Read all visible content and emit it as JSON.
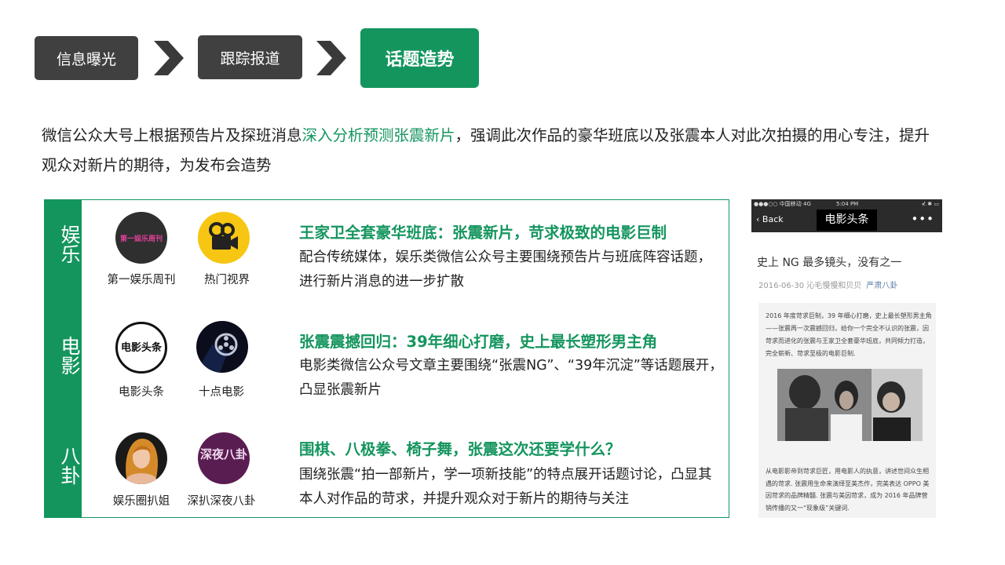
{
  "steps": [
    "信息曝光",
    "跟踪报道",
    "话题造势"
  ],
  "intro": {
    "part1": "微信公众大号上根据预告片及探班消息",
    "highlight": "深入分析预测张震新片",
    "part2": "，强调此次作品的豪华班底以及张震本人对此次拍摄的用心专注，提升观众对新片的期待，为发布会造势"
  },
  "categories": [
    {
      "label": "娱乐",
      "accounts": [
        {
          "name": "第一娱乐周刊",
          "logo_text": "第一娱乐周刊"
        },
        {
          "name": "热门视界",
          "icon": "film-camera-icon"
        }
      ],
      "headline": "王家卫全套豪华班底：张震新片，苛求极致的电影巨制",
      "description": "配合传统媒体，娱乐类微信公众号主要围绕预告片与班底阵容话题，进行新片消息的进一步扩散"
    },
    {
      "label": "电影",
      "accounts": [
        {
          "name": "电影头条",
          "logo_text": "电影头条"
        },
        {
          "name": "十点电影",
          "icon": "film-projector-icon"
        }
      ],
      "headline": "张震震撼回归：39年细心打磨，史上最长塑形男主角",
      "description": "电影类微信公众号文章主要围绕“张震NG”、“39年沉淀”等话题展开，凸显张震新片"
    },
    {
      "label": "八卦",
      "accounts": [
        {
          "name": "娱乐圈扒姐",
          "icon": "woman-portrait-icon"
        },
        {
          "name": "深扒深夜八卦",
          "logo_text": "深夜八卦"
        }
      ],
      "headline": "围棋、八极拳、椅子舞，张震这次还要学什么？",
      "description": "围绕张震“拍一部新片，学一项新技能”的特点展开话题讨论，凸显其本人对作品的苛求，并提升观众对于新片的期待与关注"
    }
  ],
  "phone": {
    "status_carrier": "●●●○○ 中国移动  4G",
    "status_time": "5:04 PM",
    "status_right": "⊀ ✱ ▭",
    "back": "Back",
    "title": "电影头条",
    "more": "•••",
    "article_title": "史上 NG 最多镜头，没有之一",
    "meta_date": "2016-06-30  沁毛慢慢和贝贝",
    "meta_source": "严肃八卦",
    "para1": "2016 年度苛求巨制，39 年细心打磨，史上最长塑形男主角——张震再一次震撼回归，给你一个完全不认识的张震，因苛求而进化的张震与王家卫全套豪华班底，共同倾力打造，完全崭新、苛求至极的电影巨制.",
    "para2": "从电影影帝到苛求巨匠，用电影人的执意，讲述世间众生相遇的苛求. 张震用生命来演绎至美杰作，完美表达 OPPO 美因苛求的品牌精髓. 张震与美因苛求，成为 2016 年品牌营销传播的又一“现象级”关键词."
  },
  "colors": {
    "green": "#14955e",
    "dark": "#404040"
  }
}
